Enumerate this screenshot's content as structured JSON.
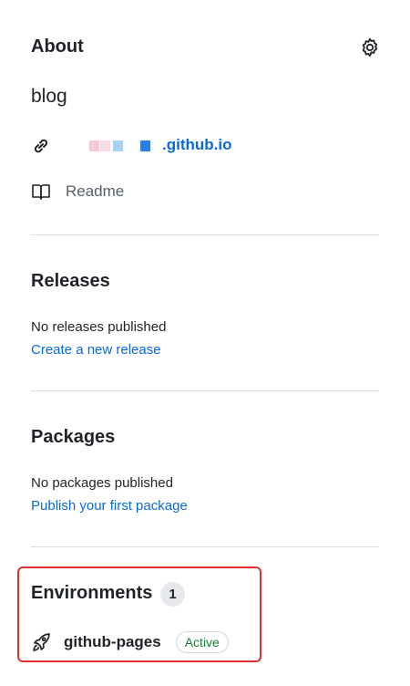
{
  "about": {
    "title": "About",
    "description": "blog",
    "website_suffix": ".github.io",
    "readme_label": "Readme",
    "blur_colors": [
      "#f3c9da",
      "#f6dbe4",
      "#a9d2f2",
      "#2f7de1"
    ]
  },
  "releases": {
    "title": "Releases",
    "empty_text": "No releases published",
    "create_link": "Create a new release"
  },
  "packages": {
    "title": "Packages",
    "empty_text": "No packages published",
    "publish_link": "Publish your first package"
  },
  "environments": {
    "title": "Environments",
    "count": "1",
    "items": [
      {
        "name": "github-pages",
        "status": "Active"
      }
    ]
  },
  "colors": {
    "link": "#0969da",
    "active_status": "#1a7f37",
    "highlight_border": "#e03131"
  }
}
